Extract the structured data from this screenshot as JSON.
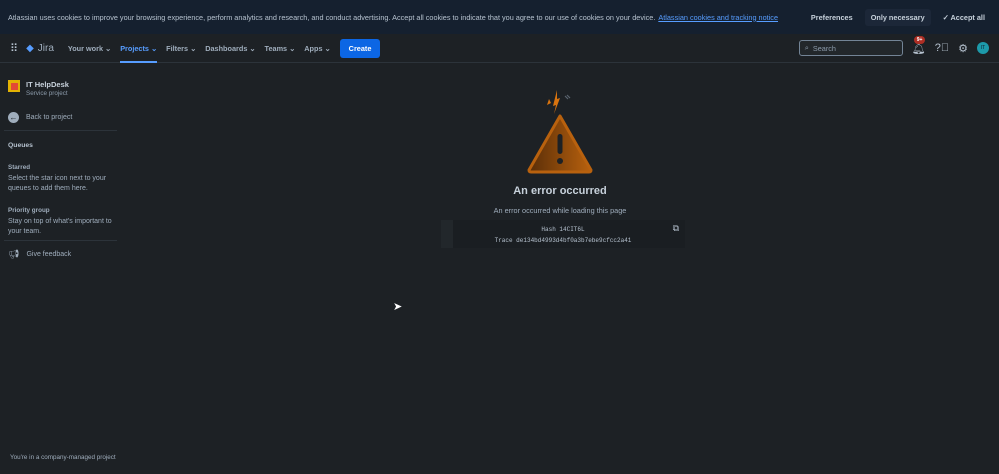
{
  "banner": {
    "text": "Atlassian uses cookies to improve your browsing experience, perform analytics and research, and conduct advertising. Accept all cookies to indicate that you agree to our use of cookies on your device.",
    "link": "Atlassian cookies and tracking notice",
    "preferences": "Preferences",
    "only_necessary": "Only necessary",
    "accept_all": "Accept all"
  },
  "nav": {
    "app": "Jira",
    "items": [
      "Your work",
      "Projects",
      "Filters",
      "Dashboards",
      "Teams",
      "Apps"
    ],
    "create": "Create",
    "search_placeholder": "Search",
    "notif_badge": "9+",
    "avatar": "IT"
  },
  "sidebar": {
    "project_name": "IT HelpDesk",
    "project_type": "Service project",
    "back": "Back to project",
    "queues": "Queues",
    "starred_title": "Starred",
    "starred_text": "Select the star icon next to your queues to add them here.",
    "priority_title": "Priority group",
    "priority_text": "Stay on top of what's important to your team.",
    "feedback": "Give feedback",
    "footer": "You're in a company-managed project"
  },
  "error": {
    "title": "An error occurred",
    "subtitle": "An error occurred while loading this page",
    "hash": "Hash 14CIT6L",
    "trace": "Trace de134bd4993d4bf0a3b7ebe9cfcc2a41"
  }
}
